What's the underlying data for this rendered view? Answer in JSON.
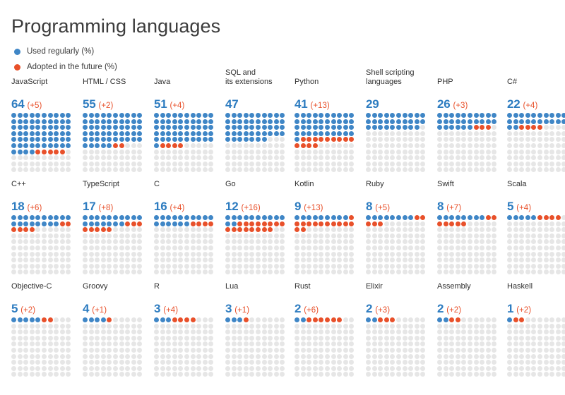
{
  "header": {
    "title": "Programming languages"
  },
  "legend": {
    "items": [
      {
        "label": "Used regularly (%)",
        "color": "#3f86c6",
        "key": "used"
      },
      {
        "label": "Adopted in the future (%)",
        "color": "#e8502a",
        "key": "future"
      }
    ]
  },
  "chart_data": {
    "type": "waffle",
    "title": "Programming languages",
    "xlabel": "",
    "ylabel": "",
    "grid_columns": 10,
    "grid_rows": 10,
    "unit": "percent",
    "colors": {
      "used": "#3f86c6",
      "future": "#e8502a",
      "empty": "#e6e6e6",
      "title": "#3c3c3c",
      "value": "#2d7cc0"
    },
    "legend_position": "top-left",
    "series": [
      {
        "name": "Used regularly (%)",
        "key": "used"
      },
      {
        "name": "Adopted in the future (%)",
        "key": "future"
      }
    ],
    "categories": [
      "JavaScript",
      "HTML / CSS",
      "Java",
      "SQL and its extensions",
      "Python",
      "Shell scripting languages",
      "PHP",
      "C#",
      "C++",
      "TypeScript",
      "C",
      "Go",
      "Kotlin",
      "Ruby",
      "Swift",
      "Scala",
      "Objective-C",
      "Groovy",
      "R",
      "Lua",
      "Rust",
      "Elixir",
      "Assembly",
      "Haskell"
    ],
    "used_values": [
      64,
      55,
      51,
      47,
      41,
      29,
      26,
      22,
      18,
      17,
      16,
      12,
      9,
      8,
      8,
      5,
      5,
      4,
      3,
      3,
      2,
      2,
      2,
      1
    ],
    "future_values": [
      5,
      2,
      4,
      0,
      13,
      0,
      3,
      4,
      6,
      8,
      4,
      16,
      13,
      5,
      7,
      4,
      2,
      1,
      4,
      1,
      6,
      3,
      2,
      2
    ]
  },
  "rows": [
    {
      "cells": [
        {
          "label": "JavaScript",
          "value": "64",
          "delta": "(+5)",
          "used": 64,
          "future": 5
        },
        {
          "label": "HTML / CSS",
          "value": "55",
          "delta": "(+2)",
          "used": 55,
          "future": 2
        },
        {
          "label": "Java",
          "value": "51",
          "delta": "(+4)",
          "used": 51,
          "future": 4
        },
        {
          "label": "SQL and\nits extensions",
          "value": "47",
          "delta": "",
          "used": 47,
          "future": 0
        },
        {
          "label": "Python",
          "value": "41",
          "delta": "(+13)",
          "used": 41,
          "future": 13
        },
        {
          "label": "Shell scripting\nlanguages",
          "value": "29",
          "delta": "",
          "used": 29,
          "future": 0
        },
        {
          "label": "PHP",
          "value": "26",
          "delta": "(+3)",
          "used": 26,
          "future": 3
        },
        {
          "label": "C#",
          "value": "22",
          "delta": "(+4)",
          "used": 22,
          "future": 4
        }
      ]
    },
    {
      "cells": [
        {
          "label": "C++",
          "value": "18",
          "delta": "(+6)",
          "used": 18,
          "future": 6
        },
        {
          "label": "TypeScript",
          "value": "17",
          "delta": "(+8)",
          "used": 17,
          "future": 8
        },
        {
          "label": "C",
          "value": "16",
          "delta": "(+4)",
          "used": 16,
          "future": 4
        },
        {
          "label": "Go",
          "value": "12",
          "delta": "(+16)",
          "used": 12,
          "future": 16
        },
        {
          "label": "Kotlin",
          "value": "9",
          "delta": "(+13)",
          "used": 9,
          "future": 13
        },
        {
          "label": "Ruby",
          "value": "8",
          "delta": "(+5)",
          "used": 8,
          "future": 5
        },
        {
          "label": "Swift",
          "value": "8",
          "delta": "(+7)",
          "used": 8,
          "future": 7
        },
        {
          "label": "Scala",
          "value": "5",
          "delta": "(+4)",
          "used": 5,
          "future": 4
        }
      ]
    },
    {
      "cells": [
        {
          "label": "Objective-C",
          "value": "5",
          "delta": "(+2)",
          "used": 5,
          "future": 2
        },
        {
          "label": "Groovy",
          "value": "4",
          "delta": "(+1)",
          "used": 4,
          "future": 1
        },
        {
          "label": "R",
          "value": "3",
          "delta": "(+4)",
          "used": 3,
          "future": 4
        },
        {
          "label": "Lua",
          "value": "3",
          "delta": "(+1)",
          "used": 3,
          "future": 1
        },
        {
          "label": "Rust",
          "value": "2",
          "delta": "(+6)",
          "used": 2,
          "future": 6
        },
        {
          "label": "Elixir",
          "value": "2",
          "delta": "(+3)",
          "used": 2,
          "future": 3
        },
        {
          "label": "Assembly",
          "value": "2",
          "delta": "(+2)",
          "used": 2,
          "future": 2
        },
        {
          "label": "Haskell",
          "value": "1",
          "delta": "(+2)",
          "used": 1,
          "future": 2
        }
      ]
    }
  ]
}
